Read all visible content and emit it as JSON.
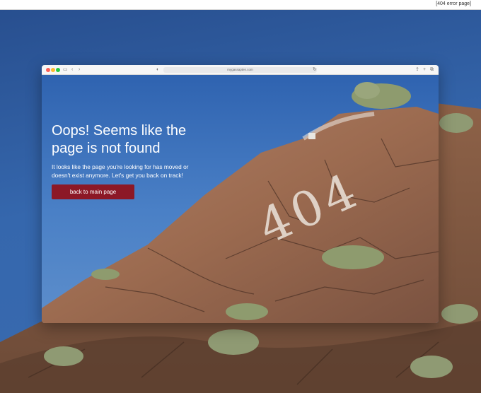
{
  "caption": "[404 error page]",
  "browser": {
    "url": "mygassapten.com"
  },
  "page": {
    "headline_line1": "Oops! Seems like the",
    "headline_line2": "page is not found",
    "body_line1": "It looks like the page you're looking for has moved or",
    "body_line2": "doesn't exist anymore. Let's get you back on track!",
    "button_label": "back to main page",
    "rock_number": "404"
  },
  "colors": {
    "sky": "#3567ad",
    "rock": "#9a6b50",
    "button": "#8c1826"
  },
  "icons": [
    "sidebar-icon",
    "back-icon",
    "forward-icon",
    "shield-icon",
    "reload-icon",
    "share-icon",
    "new-tab-icon",
    "tabs-icon"
  ]
}
